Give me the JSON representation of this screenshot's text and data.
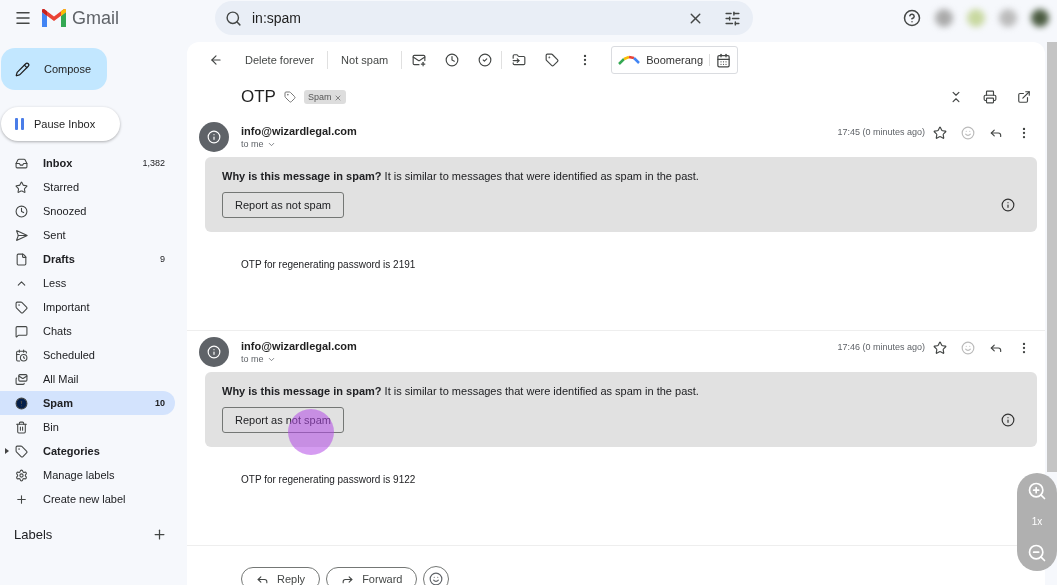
{
  "header": {
    "app_name": "Gmail",
    "search": {
      "value": "in:spam"
    }
  },
  "compose": "Compose",
  "pause_inbox": "Pause Inbox",
  "sidebar": {
    "items": [
      {
        "label": "Inbox",
        "count": "1,382",
        "bold": true,
        "selected": false
      },
      {
        "label": "Starred",
        "bold": false,
        "selected": false
      },
      {
        "label": "Snoozed",
        "bold": false,
        "selected": false
      },
      {
        "label": "Sent",
        "bold": false,
        "selected": false
      },
      {
        "label": "Drafts",
        "count": "9",
        "bold": true,
        "selected": false
      },
      {
        "label": "Less",
        "bold": false,
        "selected": false
      },
      {
        "label": "Important",
        "bold": false,
        "selected": false
      },
      {
        "label": "Chats",
        "bold": false,
        "selected": false
      },
      {
        "label": "Scheduled",
        "bold": false,
        "selected": false
      },
      {
        "label": "All Mail",
        "bold": false,
        "selected": false
      },
      {
        "label": "Spam",
        "count": "10",
        "bold": true,
        "selected": true
      },
      {
        "label": "Bin",
        "bold": false,
        "selected": false
      },
      {
        "label": "Categories",
        "bold": true,
        "selected": false,
        "expanded": false
      },
      {
        "label": "Manage labels",
        "bold": false,
        "selected": false
      },
      {
        "label": "Create new label",
        "bold": false,
        "selected": false
      }
    ]
  },
  "labels_heading": "Labels",
  "toolbar": {
    "actions": [
      "Delete forever",
      "Not spam"
    ],
    "boomerang": "Boomerang"
  },
  "thread": {
    "subject": "OTP",
    "tag": "Spam",
    "messages": [
      {
        "sender": "info@wizardlegal.com",
        "recipient": "to me",
        "time": "17:45 (0 minutes ago)",
        "warning": "**Why is this message in spam?** It is similar to messages that were identified as spam in the past.",
        "report": "Report as not spam",
        "body": "OTP for regenerating password is 2191",
        "click_marker": false
      },
      {
        "sender": "info@wizardlegal.com",
        "recipient": "to me",
        "time": "17:46 (0 minutes ago)",
        "warning": "**Why is this message in spam?** It is similar to messages that were identified as spam in the past.",
        "report": "Report as not spam",
        "body": "OTP for regenerating password is 9122",
        "click_marker": true
      }
    ]
  },
  "reply_actions": [
    "Reply",
    "Forward"
  ],
  "zoom_control": {
    "level": "1x"
  }
}
